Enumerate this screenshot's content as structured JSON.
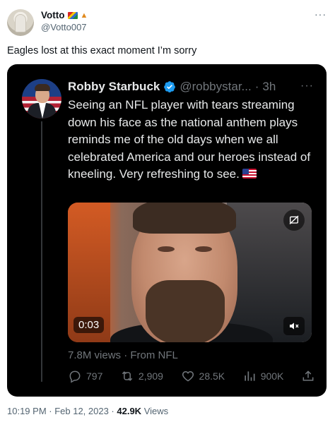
{
  "outer": {
    "name": "Votto",
    "handle": "@Votto007",
    "text": "Eagles lost at this exact moment I’m sorry"
  },
  "quoted": {
    "name": "Robby Starbuck",
    "handle": "@robbystar...",
    "separator": "·",
    "time": "3h",
    "text": "Seeing an NFL player with tears streaming down his face as the national anthem plays reminds me of the old days when we all celebrated America and our heroes instead of kneeling. Very refreshing to see.",
    "video_time": "0:03",
    "views_line": "7.8M views · From NFL",
    "replies": "797",
    "retweets": "2,909",
    "likes": "28.5K",
    "views": "900K"
  },
  "footer": {
    "time_date": "10:19 PM · Feb 12, 2023 · ",
    "views_count": "42.9K",
    "views_label": " Views"
  },
  "colors": {
    "verified": "#1d9bf0",
    "card_bg": "#000000",
    "muted_dark": "#71767b",
    "muted_light": "#536471"
  },
  "icons": [
    "more-icon",
    "verified-badge-icon",
    "reply-icon",
    "retweet-icon",
    "like-icon",
    "views-icon",
    "share-icon",
    "mute-icon",
    "sensitive-media-icon",
    "us-flag-icon"
  ]
}
